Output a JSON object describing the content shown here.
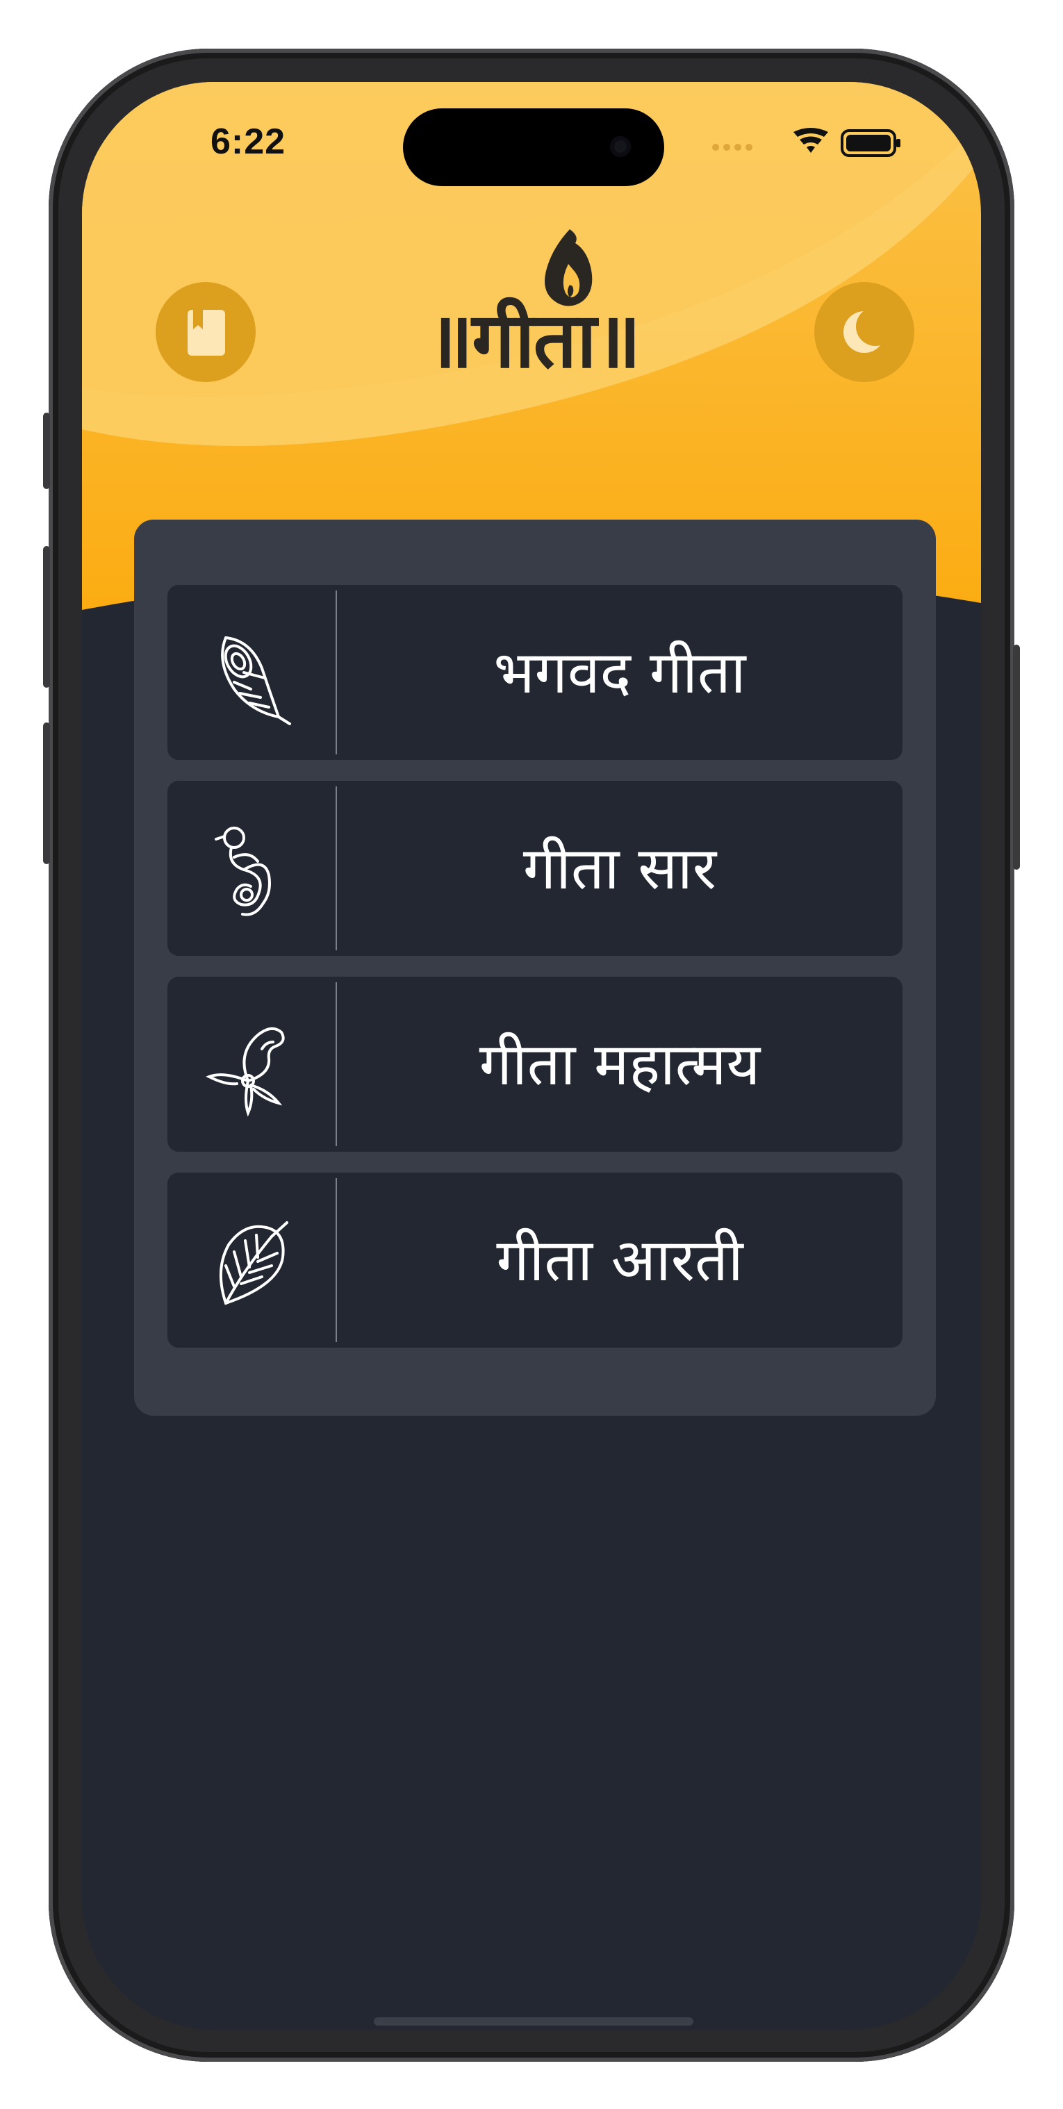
{
  "status_bar": {
    "time": "6:22"
  },
  "header": {
    "logo_text": "॥गीता॥",
    "left_button_icon": "bookmark-book-icon",
    "right_button_icon": "moon-icon"
  },
  "menu": {
    "items": [
      {
        "label": "भगवद गीता",
        "icon": "peacock-feather-icon"
      },
      {
        "label": "गीता सार",
        "icon": "peacock-icon"
      },
      {
        "label": "गीता महात्मय",
        "icon": "paisley-flower-icon"
      },
      {
        "label": "गीता आरती",
        "icon": "leaf-icon"
      }
    ]
  },
  "colors": {
    "header_gold": "#fbbd31",
    "header_gold_light": "#fbd068",
    "header_orange": "#fbac12",
    "background": "#222731",
    "card": "#393d47",
    "button_gold": "#dd9f1e",
    "icon_cream": "#fde7b6",
    "text": "#ffffff"
  }
}
